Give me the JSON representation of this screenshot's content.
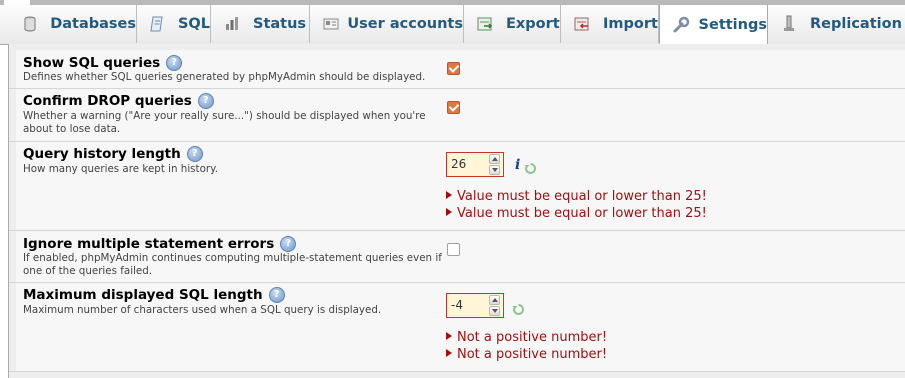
{
  "tabs": [
    {
      "key": "databases",
      "label": "Databases",
      "icon": "database-icon",
      "active": false
    },
    {
      "key": "sql",
      "label": "SQL",
      "icon": "sql-icon",
      "active": false
    },
    {
      "key": "status",
      "label": "Status",
      "icon": "status-icon",
      "active": false
    },
    {
      "key": "user_accounts",
      "label": "User accounts",
      "icon": "user-accounts-icon",
      "active": false
    },
    {
      "key": "export",
      "label": "Export",
      "icon": "export-icon",
      "active": false
    },
    {
      "key": "import",
      "label": "Import",
      "icon": "import-icon",
      "active": false
    },
    {
      "key": "settings",
      "label": "Settings",
      "icon": "wrench-icon",
      "active": true
    },
    {
      "key": "replication",
      "label": "Replication",
      "icon": "replication-icon",
      "active": false
    }
  ],
  "settings": {
    "show_sql": {
      "label": "Show SQL queries",
      "desc": "Defines whether SQL queries generated by phpMyAdmin should be displayed.",
      "checked": true
    },
    "confirm_drop": {
      "label": "Confirm DROP queries",
      "desc_line1": "Whether a warning (\"Are your really sure...\") should be displayed when you're",
      "desc_line2": "about to lose data.",
      "checked": true
    },
    "query_history": {
      "label": "Query history length",
      "desc": "How many queries are kept in history.",
      "value": "26",
      "info_icon": "i",
      "errors": [
        "Value must be equal or lower than 25!",
        "Value must be equal or lower than 25!"
      ]
    },
    "ignore_errors": {
      "label": "Ignore multiple statement errors",
      "desc_line1": "If enabled, phpMyAdmin continues computing multiple-statement queries even if",
      "desc_line2": "one of the queries failed.",
      "checked": false
    },
    "max_sql_length": {
      "label": "Maximum displayed SQL length",
      "desc": "Maximum number of characters used when a SQL query is displayed.",
      "value": "-4",
      "errors": [
        "Not a positive number!",
        "Not a positive number!"
      ]
    }
  },
  "colors": {
    "tab_text": "#235a81",
    "error_text": "#a01010",
    "invalid_border": "#c2392b",
    "invalid_bg": "#fff6d8",
    "checkbox_checked": "#e0773f"
  }
}
